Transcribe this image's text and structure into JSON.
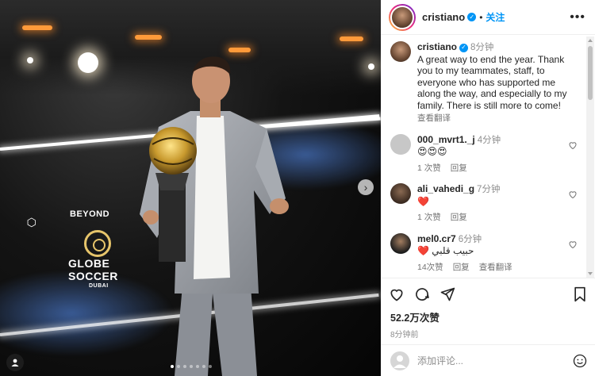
{
  "post": {
    "username": "cristiano",
    "follow_label": "关注",
    "separator": "•",
    "more_label": "•••",
    "caption_time": "8分钟",
    "caption_text": "A great way to end the year. Thank you to my teammates, staff, to everyone who has supported me along the way, and especially to my family. There is still more to come!",
    "translate_label": "查看翻译"
  },
  "comments": [
    {
      "name": "000_mvrt1._j",
      "time": "4分钟",
      "text": "😍😍😍",
      "likes": "1 次赞",
      "reply": "回复"
    },
    {
      "name": "ali_vahedi_g",
      "time": "7分钟",
      "text": "❤️",
      "likes": "1 次赞",
      "reply": "回复"
    },
    {
      "name": "mel0.cr7",
      "time": "6分钟",
      "text": "❤️ حبيب قلبي",
      "likes": "14次赞",
      "reply": "回复",
      "translate": "查看翻译"
    }
  ],
  "footer": {
    "likes_count": "52.2万次赞",
    "ago": "8分钟前",
    "comment_placeholder": "添加评论..."
  },
  "media": {
    "brand_top": "BEYOND",
    "brand_mid": "GLOBE",
    "brand_mid2": "SOCCER",
    "brand_bottom": "DUBAI",
    "next_label": "›"
  },
  "colors": {
    "accent": "#0095f6",
    "like_red": "#ed4956"
  },
  "icons": [
    "heart-icon",
    "comment-icon",
    "share-icon",
    "bookmark-icon",
    "emoji-icon",
    "verified-icon",
    "more-icon",
    "chevron-right-icon"
  ]
}
